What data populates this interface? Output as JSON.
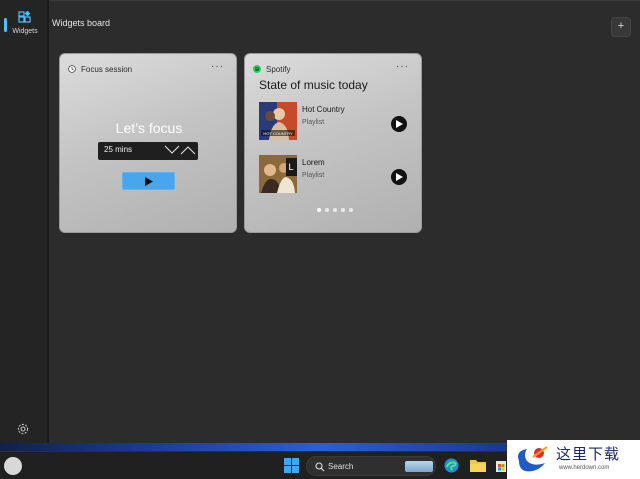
{
  "rail": {
    "widgets_label": "Widgets"
  },
  "board": {
    "title": "Widgets board",
    "add_label": "+"
  },
  "focus_widget": {
    "app_name": "Focus session",
    "more_label": "···",
    "heading": "Let’s focus",
    "duration_value": "25 mins"
  },
  "spotify_widget": {
    "app_name": "Spotify",
    "more_label": "···",
    "heading": "State of music today",
    "tracks": [
      {
        "title": "Hot Country",
        "subtitle": "Playlist",
        "art_caption": "HOT COUNTRY"
      },
      {
        "title": "Lorem",
        "subtitle": "Playlist",
        "art_caption": "L"
      }
    ],
    "page_count": 5,
    "active_page": 1
  },
  "taskbar": {
    "search_placeholder": "Search"
  },
  "watermark": {
    "chinese": "这里下载",
    "url": "www.herdown.com"
  },
  "colors": {
    "accent": "#4cc2ff",
    "focus_play": "#4aa6ec",
    "spotify_green": "#1ed760"
  }
}
